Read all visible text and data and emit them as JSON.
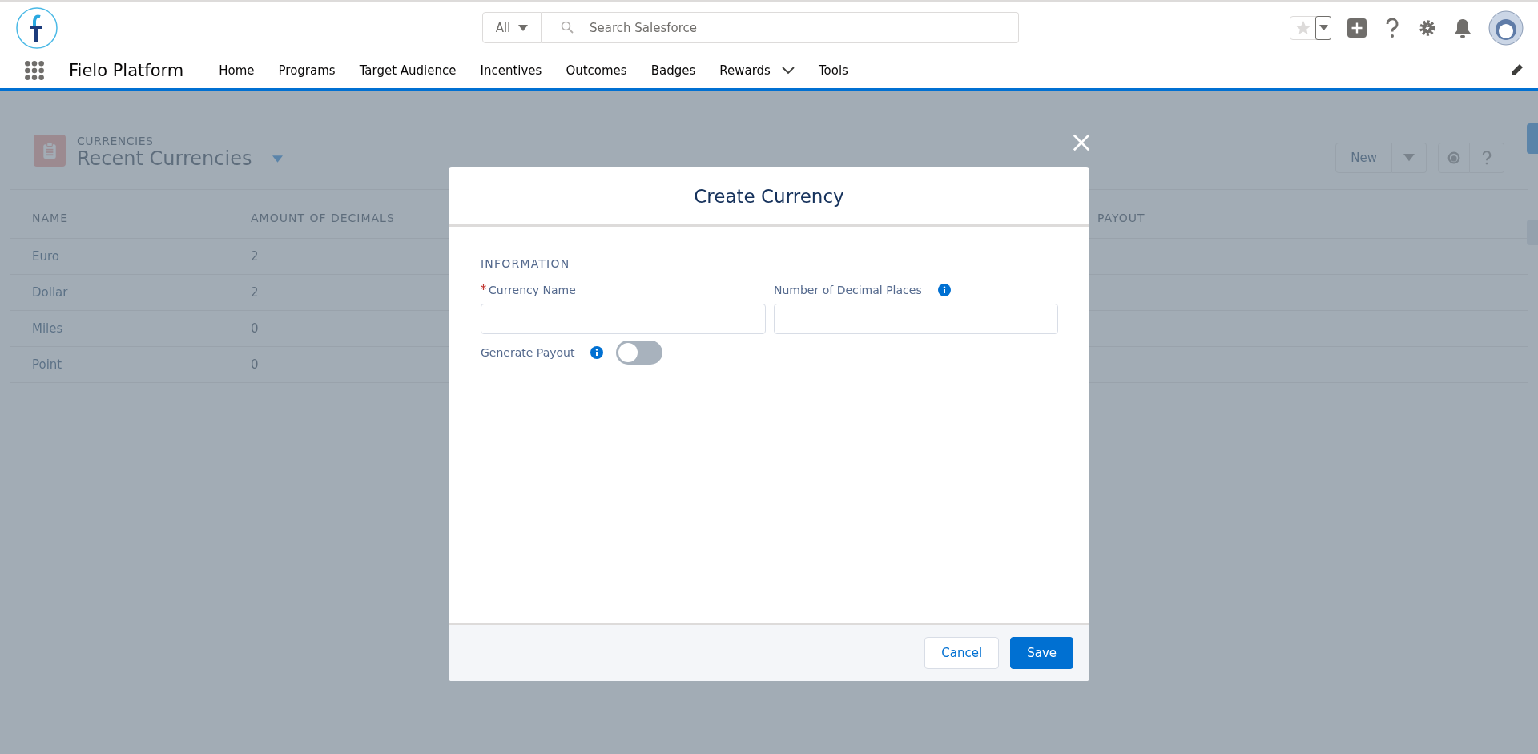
{
  "header": {
    "search": {
      "scope": "All",
      "placeholder": "Search Salesforce"
    }
  },
  "nav": {
    "app_name": "Fielo Platform",
    "items": [
      {
        "label": "Home",
        "has_menu": false
      },
      {
        "label": "Programs",
        "has_menu": false
      },
      {
        "label": "Target Audience",
        "has_menu": false
      },
      {
        "label": "Incentives",
        "has_menu": false
      },
      {
        "label": "Outcomes",
        "has_menu": false
      },
      {
        "label": "Badges",
        "has_menu": false
      },
      {
        "label": "Rewards",
        "has_menu": true
      },
      {
        "label": "Tools",
        "has_menu": false
      }
    ]
  },
  "list_view": {
    "object": "CURRENCIES",
    "title": "Recent Currencies",
    "new_button": "New",
    "columns": [
      "NAME",
      "AMOUNT OF DECIMALS",
      "PAYOUT"
    ],
    "rows": [
      {
        "name": "Euro",
        "decimals": "2"
      },
      {
        "name": "Dollar",
        "decimals": "2"
      },
      {
        "name": "Miles",
        "decimals": "0"
      },
      {
        "name": "Point",
        "decimals": "0"
      }
    ]
  },
  "modal": {
    "title": "Create Currency",
    "section": "INFORMATION",
    "fields": [
      {
        "label": "Currency Name",
        "required": true,
        "info": false
      },
      {
        "label": "Number of Decimal Places",
        "required": false,
        "info": true
      }
    ],
    "toggle": {
      "label": "Generate Payout",
      "on": false
    },
    "buttons": [
      {
        "label": "Cancel",
        "kind": "neutral"
      },
      {
        "label": "Save",
        "kind": "brand"
      }
    ]
  }
}
